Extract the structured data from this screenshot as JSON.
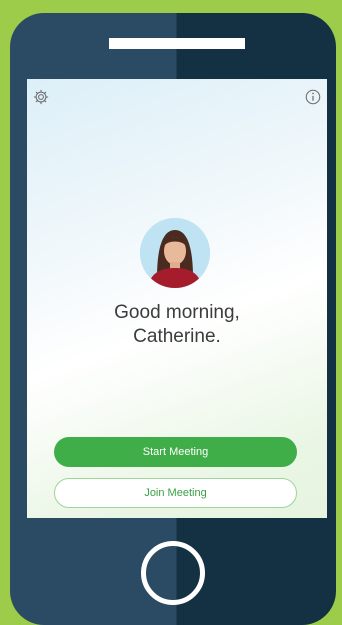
{
  "greeting": {
    "line1": "Good morning,",
    "line2": "Catherine."
  },
  "actions": {
    "start_label": "Start Meeting",
    "join_label": "Join Meeting"
  },
  "icons": {
    "settings": "gear-icon",
    "info": "info-icon",
    "home": "home-button"
  },
  "colors": {
    "accent": "#3fae49",
    "background": "#9ccc4a",
    "phone_light": "#2a4b63",
    "phone_dark": "#143144"
  }
}
